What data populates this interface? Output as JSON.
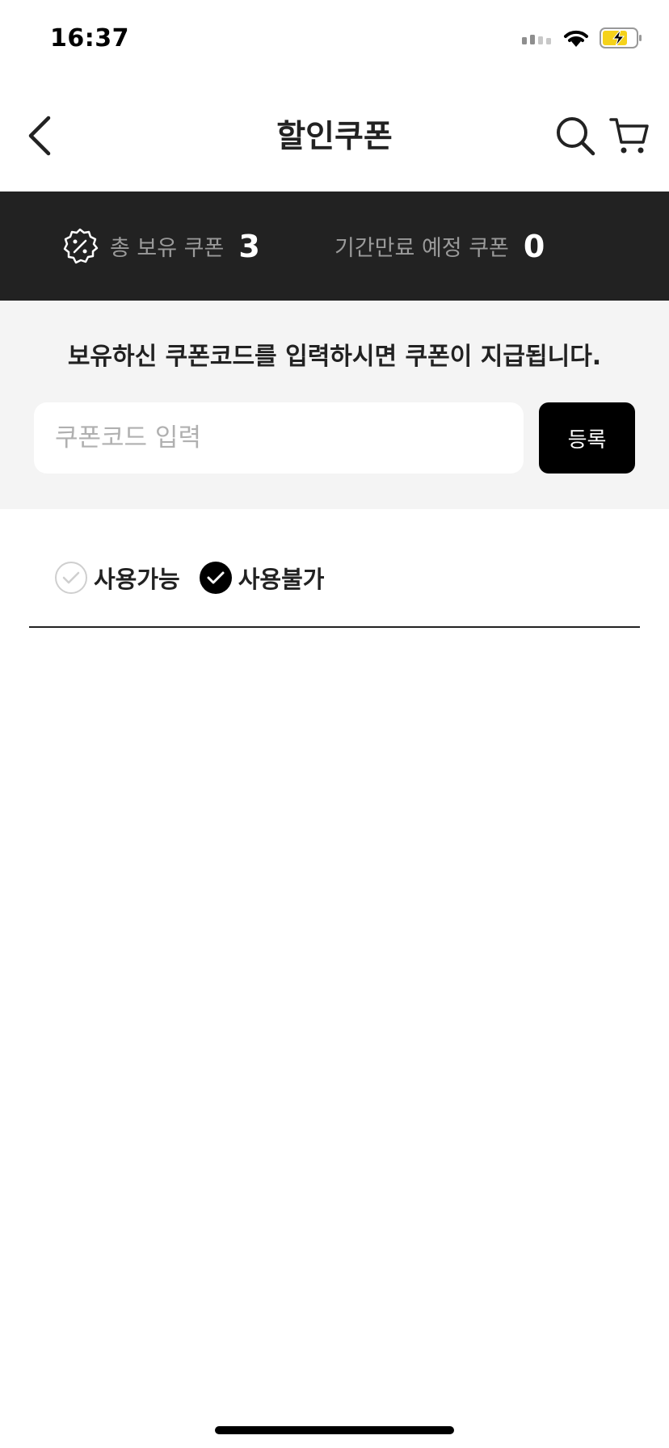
{
  "status_bar": {
    "time": "16:37",
    "icons": [
      "signal-icon",
      "wifi-icon",
      "battery-charging-icon"
    ],
    "battery_color": "#f5d21a"
  },
  "header": {
    "title": "할인쿠폰",
    "icons": [
      "back-chevron-icon",
      "search-icon",
      "cart-icon"
    ]
  },
  "summary": {
    "total_label": "총 보유 쿠폰",
    "total_count": "3",
    "expiring_label": "기간만료 예정 쿠폰",
    "expiring_count": "0",
    "background": "#222222"
  },
  "code_register": {
    "guide": "보유하신 쿠폰코드를 입력하시면 쿠폰이 지급됩니다.",
    "value": "",
    "placeholder": "쿠폰코드 입력",
    "button_label": "등록"
  },
  "filter": {
    "options": [
      {
        "label": "사용가능",
        "checked": false
      },
      {
        "label": "사용불가",
        "checked": true
      }
    ]
  },
  "colors": {
    "accent": "#000000",
    "section_bg": "#f4f4f4"
  }
}
